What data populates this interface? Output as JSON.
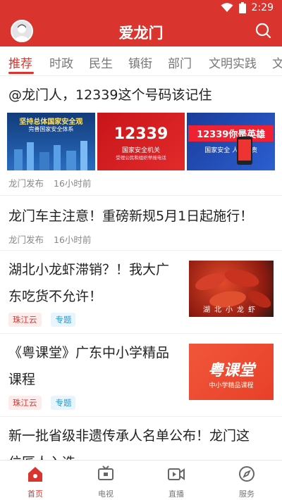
{
  "status": {
    "time": "2:29"
  },
  "header": {
    "title": "爱龙门"
  },
  "tabs": [
    "推荐",
    "时政",
    "民生",
    "镇街",
    "部门",
    "文明实践",
    "文"
  ],
  "colors": {
    "brand": "#d9352e",
    "tag_blue": "#2a9ad8"
  },
  "articles": [
    {
      "title": "@龙门人，12339这个号码该记住",
      "source": "龙门发布",
      "time": "16小时前",
      "images": [
        {
          "caption": "坚持总体国家安全观",
          "sub": "完善国家安全体系"
        },
        {
          "number": "12339",
          "caption": "国家安全机关",
          "sub": "受理公民和组织举报电话"
        },
        {
          "caption": "12339你是英雄",
          "sub": "国家安全 人人有责"
        }
      ]
    },
    {
      "title": "龙门车主注意！重磅新规5月1日起施行！",
      "source": "龙门发布",
      "time": "16小时前"
    },
    {
      "title_line1": "湖北小龙虾滞销？！我大广",
      "title_line2": "东吃货不允许！",
      "tags": [
        "珠江云",
        "专题"
      ],
      "thumb_caption": "湖北小龙虾"
    },
    {
      "title_line1": "《粤课堂》广东中小学精品",
      "title_line2": "课程",
      "tags": [
        "珠江云",
        "专题"
      ],
      "thumb_title": "粤课堂",
      "thumb_sub": "中小学精品课程"
    },
    {
      "title_line1": "新一批省级非遗传承人名单公布！龙门这",
      "title_line2": "位匠人入选"
    }
  ],
  "bottom_nav": [
    {
      "label": "首页",
      "icon": "home-icon",
      "active": true
    },
    {
      "label": "电视",
      "icon": "tv-icon"
    },
    {
      "label": "直播",
      "icon": "live-video-icon"
    },
    {
      "label": "服务",
      "icon": "compass-icon"
    }
  ]
}
